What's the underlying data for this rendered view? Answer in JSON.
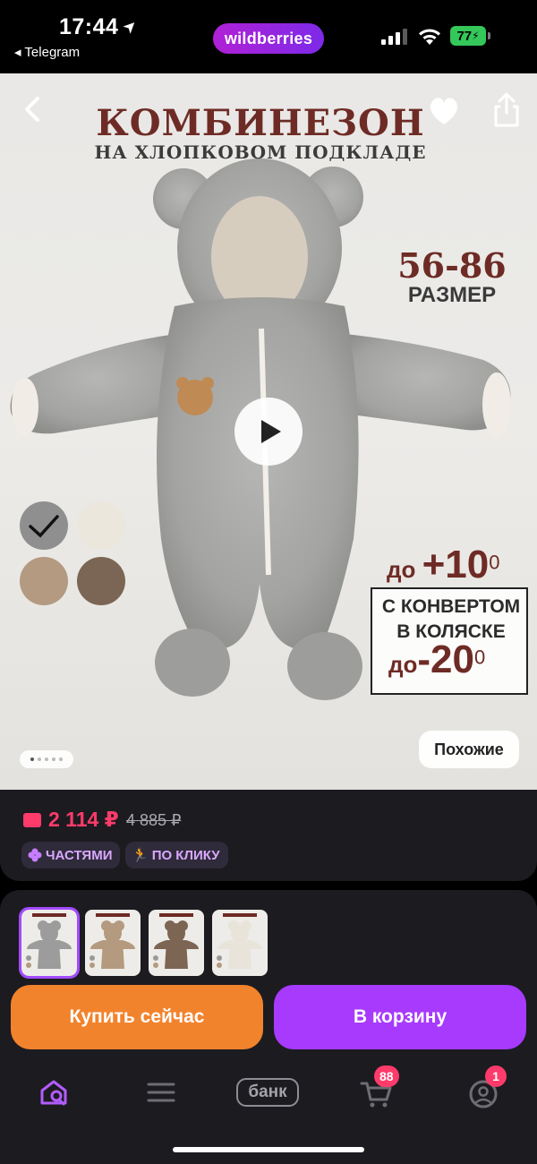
{
  "status_bar": {
    "time": "17:44",
    "back_app": "◂ Telegram",
    "brand": "wildberries",
    "battery": "77"
  },
  "product_image": {
    "title": "КОМБИНЕЗОН",
    "subtitle": "НА ХЛОПКОВОМ ПОДКЛАДЕ",
    "size_range": "56-86",
    "size_label": "РАЗМЕР",
    "temp_plus_prefix": "до ",
    "temp_plus_value": "+10",
    "temp_degree": "0",
    "envelope_line1": "С КОНВЕРТОМ",
    "envelope_line2": "В КОЛЯСКЕ",
    "temp_minus_prefix": "до",
    "temp_minus_value": "-20",
    "similar_button": "Похожие",
    "carousel_dots": 5,
    "carousel_active": 1
  },
  "color_swatches": [
    {
      "name": "grey",
      "color": "#8f8f8f",
      "selected": true
    },
    {
      "name": "milk",
      "color": "#ece7dc",
      "selected": false
    },
    {
      "name": "beige",
      "color": "#b39a80",
      "selected": false
    },
    {
      "name": "brown",
      "color": "#7b6554",
      "selected": false
    }
  ],
  "price": {
    "current": "2 114 ₽",
    "old": "4 885 ₽",
    "chips": [
      "ЧАСТЯМИ",
      "ПО КЛИКУ"
    ]
  },
  "thumbnails": [
    {
      "color": "#9c9c9c",
      "selected": true
    },
    {
      "color": "#b49a7e",
      "selected": false
    },
    {
      "color": "#7d6554",
      "selected": false
    },
    {
      "color": "#e8e4da",
      "selected": false
    }
  ],
  "actions": {
    "buy_now": "Купить сейчас",
    "add_to_cart": "В корзину"
  },
  "nav": {
    "bank_label": "банк",
    "cart_badge": "88",
    "profile_badge": "1"
  },
  "colors": {
    "accent_purple": "#a73afd",
    "accent_orange": "#f2832d",
    "price_red": "#ff3b6b",
    "title_brown": "#6e2b25"
  }
}
